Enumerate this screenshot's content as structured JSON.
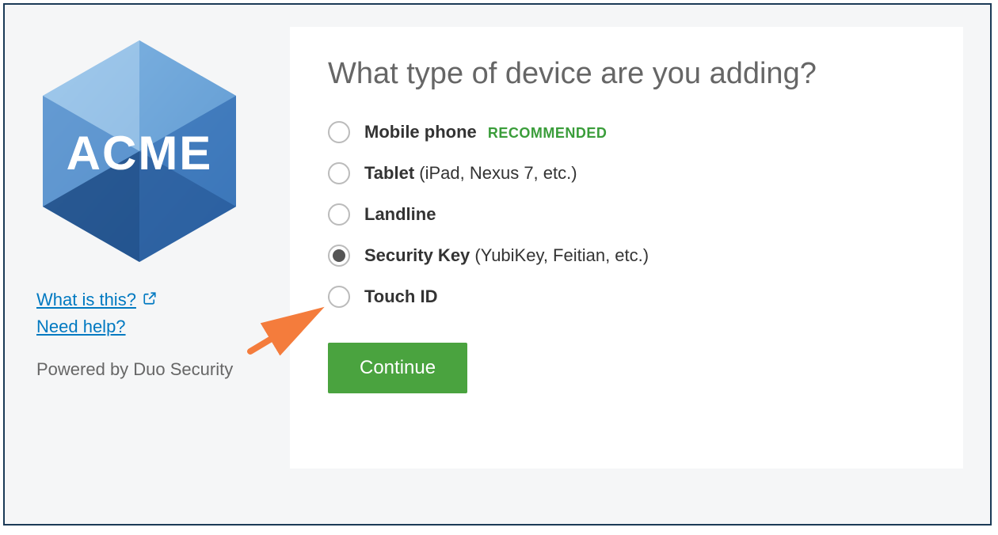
{
  "brand": {
    "name": "ACME"
  },
  "sidebar": {
    "whatIsThis": "What is this?",
    "needHelp": "Need help?",
    "poweredBy": "Powered by Duo Security"
  },
  "main": {
    "title": "What type of device are you adding?",
    "options": [
      {
        "label": "Mobile phone",
        "paren": "",
        "badge": "RECOMMENDED",
        "selected": false
      },
      {
        "label": "Tablet",
        "paren": " (iPad, Nexus 7, etc.)",
        "badge": "",
        "selected": false
      },
      {
        "label": "Landline",
        "paren": "",
        "badge": "",
        "selected": false
      },
      {
        "label": "Security Key",
        "paren": " (YubiKey, Feitian, etc.)",
        "badge": "",
        "selected": true
      },
      {
        "label": "Touch ID",
        "paren": "",
        "badge": "",
        "selected": false
      }
    ],
    "continueLabel": "Continue"
  },
  "colors": {
    "accentGreen": "#4aa33f",
    "link": "#0079c1",
    "arrow": "#f47c3c"
  }
}
